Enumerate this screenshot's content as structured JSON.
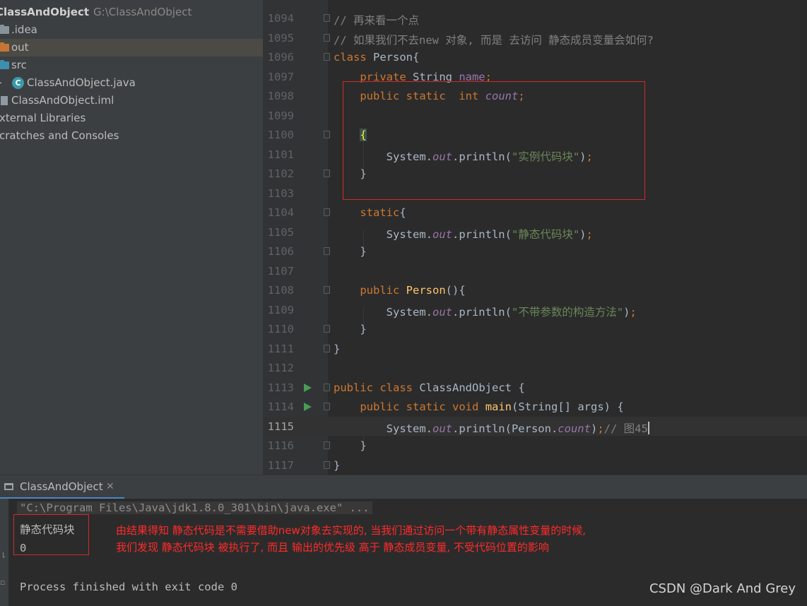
{
  "project_tree": {
    "root_name": "ClassAndObject",
    "root_path": "G:\\ClassAndObject",
    "items": [
      {
        "label": ".idea",
        "icon": "folder-icon",
        "color": "#87939a"
      },
      {
        "label": "out",
        "icon": "folder-icon",
        "color": "#c57633",
        "selected": true
      },
      {
        "label": "src",
        "icon": "folder-icon",
        "color": "#3d8fb0"
      },
      {
        "label": "ClassAndObject.java",
        "icon": "java-class-icon"
      },
      {
        "label": "ClassAndObject.iml",
        "icon": "module-file-icon"
      },
      {
        "label": "xternal Libraries"
      },
      {
        "label": "cratches and Consoles"
      }
    ]
  },
  "editor": {
    "current_line": "1115",
    "lines": [
      {
        "n": "1094",
        "text": "// 再来看一个点"
      },
      {
        "n": "1095",
        "text": "// 如果我们不去new 对象, 而是 去访问 静态成员变量会如何?"
      },
      {
        "n": "1096",
        "text": "class Person{"
      },
      {
        "n": "1097",
        "text": "    private String name;"
      },
      {
        "n": "1098",
        "text": "    public static  int count;"
      },
      {
        "n": "1099",
        "text": ""
      },
      {
        "n": "1100",
        "text": "    {"
      },
      {
        "n": "1101",
        "text": "        System.out.println(\"实例代码块\");"
      },
      {
        "n": "1102",
        "text": "    }"
      },
      {
        "n": "1103",
        "text": ""
      },
      {
        "n": "1104",
        "text": "    static{"
      },
      {
        "n": "1105",
        "text": "        System.out.println(\"静态代码块\");"
      },
      {
        "n": "1106",
        "text": "    }"
      },
      {
        "n": "1107",
        "text": ""
      },
      {
        "n": "1108",
        "text": "    public Person(){"
      },
      {
        "n": "1109",
        "text": "        System.out.println(\"不带参数的构造方法\");"
      },
      {
        "n": "1110",
        "text": "    }"
      },
      {
        "n": "1111",
        "text": "}"
      },
      {
        "n": "1112",
        "text": ""
      },
      {
        "n": "1113",
        "text": "public class ClassAndObject {"
      },
      {
        "n": "1114",
        "text": "    public static void main(String[] args) {"
      },
      {
        "n": "1115",
        "text": "        System.out.println(Person.count);// 图45"
      },
      {
        "n": "1116",
        "text": "    }"
      },
      {
        "n": "1117",
        "text": "}"
      }
    ]
  },
  "run_panel": {
    "tab_label": "ClassAndObject",
    "command": "\"C:\\Program Files\\Java\\jdk1.8.0_301\\bin\\java.exe\" ...",
    "output": [
      "静态代码块",
      "0"
    ],
    "exit_message": "Process finished with exit code 0"
  },
  "annotation": {
    "line1": "由结果得知 静态代码是不需要借助new对象去实现的, 当我们通过访问一个带有静态属性变量的时候,",
    "line2": "我们发现 静态代码块 被执行了,  而且 输出的优先级 高于 静态成员变量, 不受代码位置的影响"
  },
  "watermark": "CSDN @Dark And Grey",
  "colors": {
    "keyword": "#cc7832",
    "comment": "#808080",
    "string": "#6a8759",
    "field": "#9876aa",
    "method": "#ffc66d",
    "annotation_red": "#ff2b2b"
  }
}
